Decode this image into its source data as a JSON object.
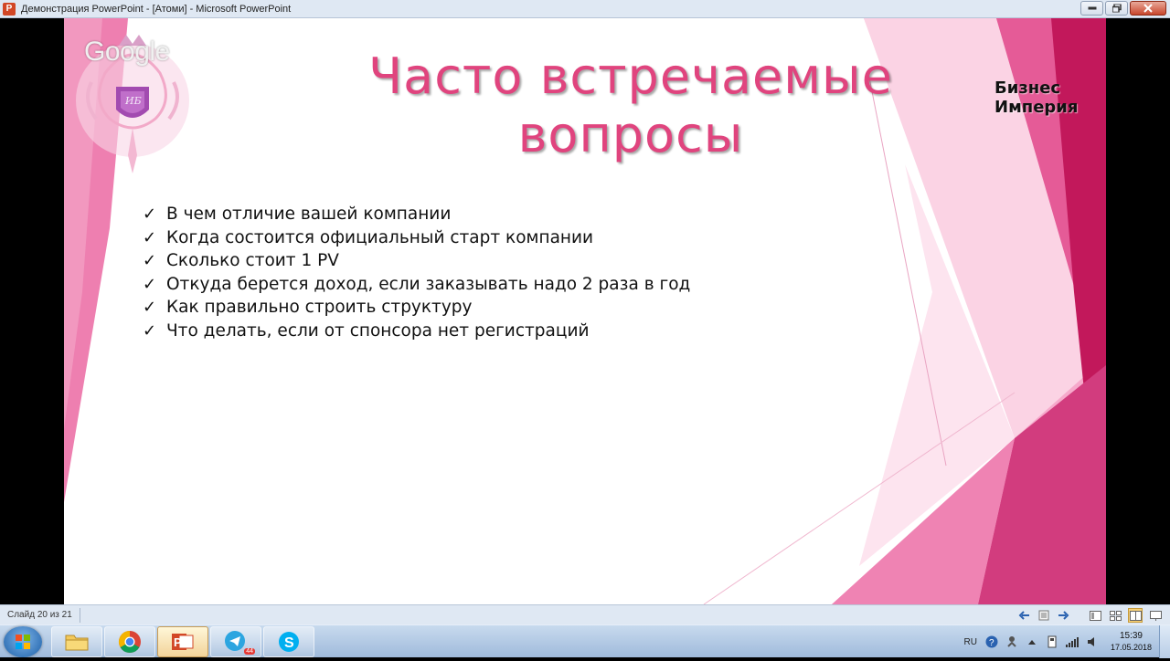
{
  "window": {
    "app_icon_letter": "P",
    "title": "Демонстрация PowerPoint - [Атоми] - Microsoft PowerPoint"
  },
  "slide": {
    "overlay_logo": "Google",
    "title_line1": "Часто встречаемые",
    "title_line2": "вопросы",
    "brand": "Бизнес Империя",
    "emblem_initials": "ИБ",
    "bullets": [
      "В чем отличие вашей компании",
      "Когда состоится официальный старт компании",
      "Сколько стоит 1 PV",
      "Откуда берется доход, если заказывать надо 2 раза в год",
      "Как правильно строить структуру",
      "Что делать, если от спонсора нет регистраций"
    ],
    "check_glyph": "✓",
    "colors": {
      "title": "#e0447e",
      "accent_dark": "#c2185b",
      "accent_light": "#f8bbd0"
    }
  },
  "statusbar": {
    "slide_counter": "Слайд 20 из 21"
  },
  "taskbar": {
    "apps": [
      "explorer",
      "chrome",
      "powerpoint",
      "telegram",
      "skype"
    ],
    "telegram_badge": "44",
    "language": "RU",
    "time": "15:39",
    "date": "17.05.2018"
  }
}
